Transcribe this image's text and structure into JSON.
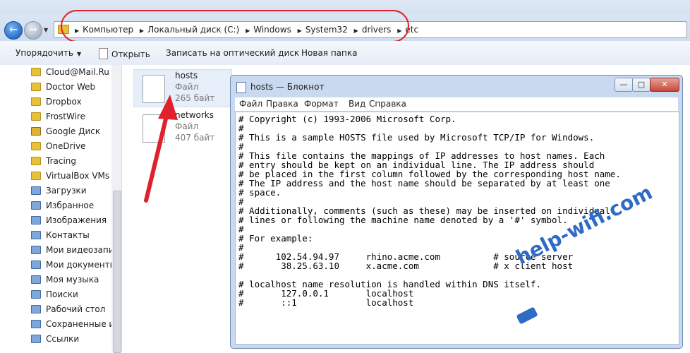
{
  "breadcrumb": [
    "Компьютер",
    "Локальный диск (C:)",
    "Windows",
    "System32",
    "drivers",
    "etc"
  ],
  "toolbar": {
    "organize": "Упорядочить",
    "open": "Открыть",
    "burn": "Записать на оптический диск",
    "new_folder": "Новая папка"
  },
  "sidebar": {
    "items": [
      {
        "label": "Cloud@Mail.Ru",
        "icon": "folder-icon"
      },
      {
        "label": "Doctor Web",
        "icon": "folder-icon"
      },
      {
        "label": "Dropbox",
        "icon": "folder-icon"
      },
      {
        "label": "FrostWire",
        "icon": "folder-icon"
      },
      {
        "label": "Google Диск",
        "icon": "locked-folder-icon"
      },
      {
        "label": "OneDrive",
        "icon": "folder-icon"
      },
      {
        "label": "Tracing",
        "icon": "folder-icon"
      },
      {
        "label": "VirtualBox VMs",
        "icon": "folder-icon"
      },
      {
        "label": "Загрузки",
        "icon": "downloads-icon"
      },
      {
        "label": "Избранное",
        "icon": "favorites-icon"
      },
      {
        "label": "Изображения",
        "icon": "pictures-icon"
      },
      {
        "label": "Контакты",
        "icon": "contacts-icon"
      },
      {
        "label": "Мои видеозапис",
        "icon": "videos-icon"
      },
      {
        "label": "Мои документы",
        "icon": "documents-icon"
      },
      {
        "label": "Моя музыка",
        "icon": "music-icon"
      },
      {
        "label": "Поиски",
        "icon": "searches-icon"
      },
      {
        "label": "Рабочий стол",
        "icon": "desktop-icon"
      },
      {
        "label": "Сохраненные игр",
        "icon": "games-icon"
      },
      {
        "label": "Ссылки",
        "icon": "links-icon"
      }
    ]
  },
  "files": [
    {
      "name": "hosts",
      "type": "Файл",
      "size": "265 байт"
    },
    {
      "name": "networks",
      "type": "Файл",
      "size": "407 байт"
    }
  ],
  "notepad": {
    "title": "hosts — Блокнот",
    "menu": [
      "Файл",
      "Правка",
      "Формат",
      "Вид",
      "Справка"
    ],
    "lines": [
      "# Copyright (c) 1993-2006 Microsoft Corp.",
      "#",
      "# This is a sample HOSTS file used by Microsoft TCP/IP for Windows.",
      "#",
      "# This file contains the mappings of IP addresses to host names. Each",
      "# entry should be kept on an individual line. The IP address should",
      "# be placed in the first column followed by the corresponding host name.",
      "# The IP address and the host name should be separated by at least one",
      "# space.",
      "#",
      "# Additionally, comments (such as these) may be inserted on individual",
      "# lines or following the machine name denoted by a '#' symbol.",
      "#",
      "# For example:",
      "#",
      "#      102.54.94.97     rhino.acme.com          # source server",
      "#       38.25.63.10     x.acme.com              # x client host",
      "",
      "# localhost name resolution is handled within DNS itself.",
      "#\t127.0.0.1       localhost",
      "#\t::1             localhost"
    ]
  },
  "watermark": "help-wifi.com",
  "colors": {
    "annotation_red": "#e0202a",
    "watermark_blue": "#2f6bc4"
  }
}
